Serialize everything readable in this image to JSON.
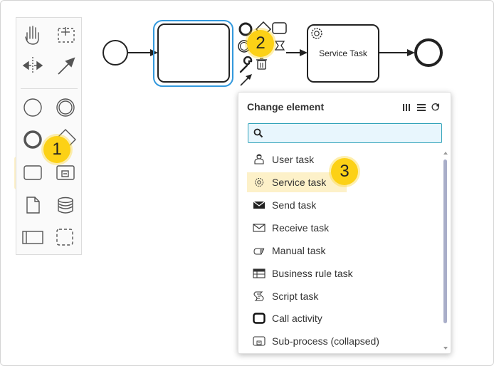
{
  "diagram": {
    "service_task_label": "Service Task"
  },
  "badges": [
    "1",
    "2",
    "3"
  ],
  "popup": {
    "title": "Change element",
    "search": {
      "value": "",
      "placeholder": ""
    },
    "items": [
      {
        "label": "User task",
        "icon": "user-icon"
      },
      {
        "label": "Service task",
        "icon": "gear-icon"
      },
      {
        "label": "Send task",
        "icon": "envelope-filled-icon"
      },
      {
        "label": "Receive task",
        "icon": "envelope-icon"
      },
      {
        "label": "Manual task",
        "icon": "hand-icon"
      },
      {
        "label": "Business rule task",
        "icon": "table-icon"
      },
      {
        "label": "Script task",
        "icon": "script-icon"
      },
      {
        "label": "Call activity",
        "icon": "call-activity-icon"
      },
      {
        "label": "Sub-process (collapsed)",
        "icon": "subprocess-collapsed-icon"
      }
    ],
    "highlighted_item": "Service task"
  },
  "colors": {
    "highlight": "#fdf1c9",
    "badge": "#fcd116",
    "selection": "#3399dd",
    "search_border": "#31a3b9"
  }
}
